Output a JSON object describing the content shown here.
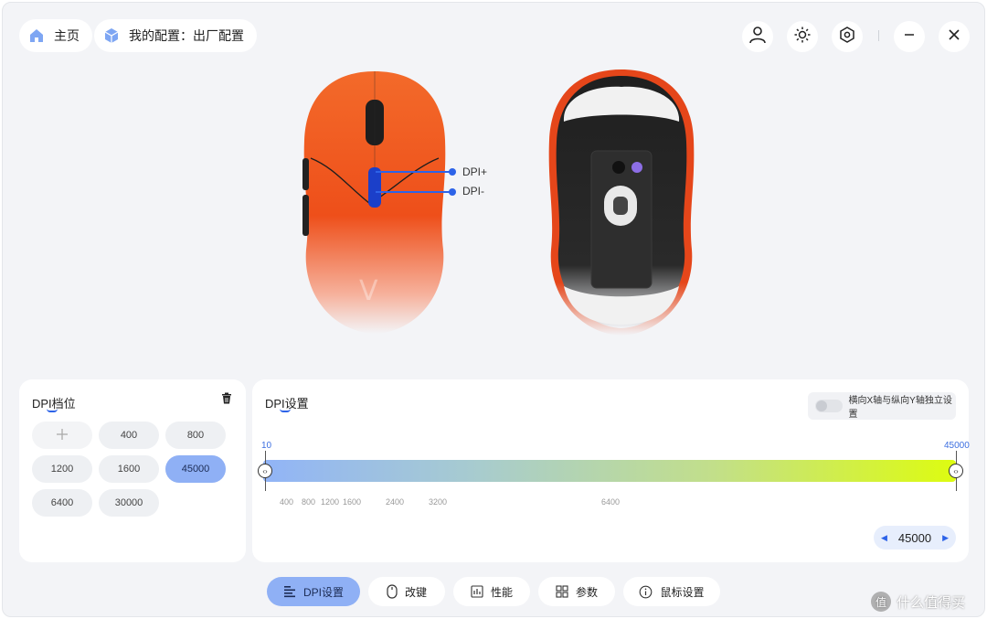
{
  "header": {
    "home_label": "主页",
    "profile_label": "我的配置：出厂配置"
  },
  "icons": {
    "home": "home-icon",
    "profile": "cube-icon",
    "user": "user-icon",
    "brightness": "sun-icon",
    "settings": "hexagon-settings-icon",
    "minimize": "minimize-icon",
    "close": "close-icon"
  },
  "callouts": {
    "dpi_up": "DPI+",
    "dpi_down": "DPI-"
  },
  "dpi_levels": {
    "title": "DPI档位",
    "values": [
      "400",
      "800",
      "1200",
      "1600",
      "45000",
      "6400",
      "30000"
    ],
    "selected": "45000"
  },
  "dpi_settings": {
    "title": "DPI设置",
    "independent_axis_label": "横向X轴与纵向Y轴独立设置",
    "independent_axis_enabled": false,
    "min": "10",
    "max": "45000",
    "current": "45000",
    "ticks": [
      "400",
      "800",
      "1200",
      "1600",
      "2400",
      "3200",
      "6400"
    ]
  },
  "nav": {
    "items": [
      "DPI设置",
      "改键",
      "性能",
      "参数",
      "鼠标设置"
    ],
    "active": "DPI设置"
  },
  "colors": {
    "accent": "#2d63e8",
    "active_button": "#8fb0f5",
    "mouse_orange": "#f05a1c"
  },
  "watermark": "什么值得买"
}
